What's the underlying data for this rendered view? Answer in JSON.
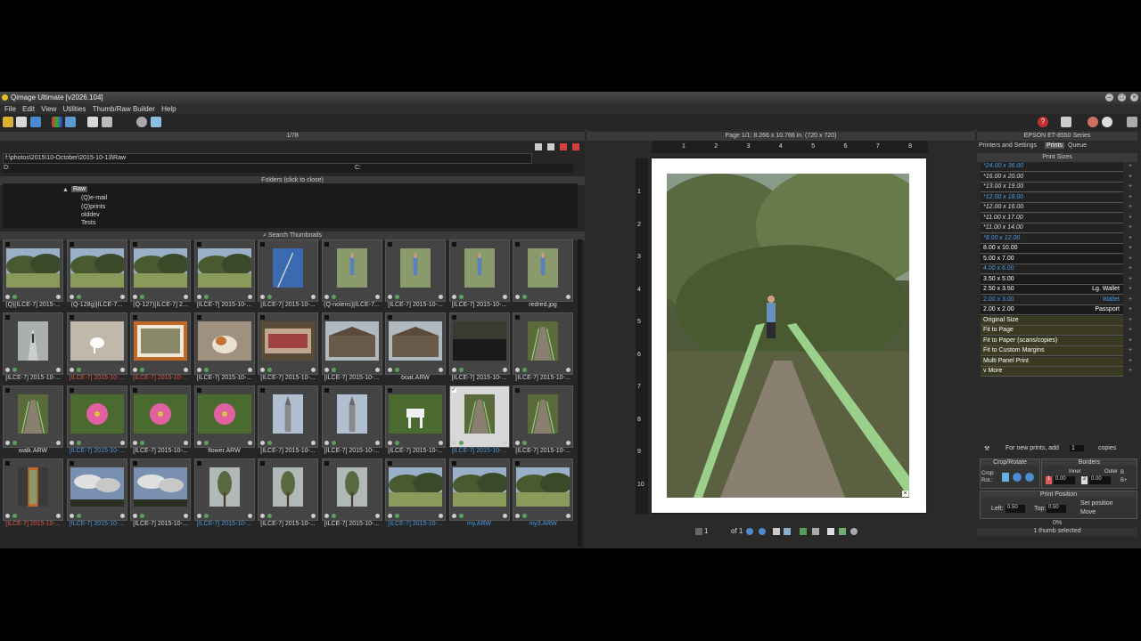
{
  "app": {
    "title": "Qimage Ultimate [v2026.104]"
  },
  "menu": [
    "File",
    "Edit",
    "View",
    "Utilities",
    "Thumb/Raw Builder",
    "Help"
  ],
  "left": {
    "page_counter": "1/78",
    "path": "f:\\photos\\2015\\10-October\\2015-10-13\\Raw",
    "drive_left": "D:",
    "drive_right": "C:",
    "folders_header": "Folders (click to close)",
    "folders": [
      "Raw",
      "(Q)e-mail",
      "(Q)prints",
      "olddev",
      "Tests"
    ],
    "search_header": "Search Thumbnails",
    "thumbnails": [
      {
        "caption": "(Q)[ILCE-7] 2015-...",
        "color": "#dddddd",
        "img": "landscape"
      },
      {
        "caption": "(Q-128g)[ILCE-7...",
        "color": "#dddddd",
        "img": "landscape"
      },
      {
        "caption": "(Q-127)[ILCE-7] 2...",
        "color": "#dddddd",
        "img": "landscape"
      },
      {
        "caption": "[ILCE-7] 2015-10-...",
        "color": "#dddddd",
        "img": "landscape"
      },
      {
        "caption": "[ILCE-7] 2015-10-...",
        "color": "#dddddd",
        "img": "sky"
      },
      {
        "caption": "(Q-nolens)[ILCE-7...",
        "color": "#dddddd",
        "img": "person"
      },
      {
        "caption": "[ILCE-7] 2015-10-...",
        "color": "#dddddd",
        "img": "person"
      },
      {
        "caption": "[ILCE-7] 2015-10-...",
        "color": "#dddddd",
        "img": "person"
      },
      {
        "caption": "redred.jpg",
        "color": "#dddddd",
        "img": "person"
      },
      {
        "caption": "[ILCE-7] 2015-10-...",
        "color": "#dddddd",
        "img": "path"
      },
      {
        "caption": "[ILCE-7] 2015-10-...",
        "color": "#e05a4a",
        "img": "dog"
      },
      {
        "caption": "[ILCE-7] 2015-10-...",
        "color": "#e05a4a",
        "img": "framed"
      },
      {
        "caption": "[ILCE-7] 2015-10-...",
        "color": "#dddddd",
        "img": "cat"
      },
      {
        "caption": "[ILCE-7] 2015-10-...",
        "color": "#dddddd",
        "img": "sign"
      },
      {
        "caption": "[ILCE-7] 2015-10-...",
        "color": "#dddddd",
        "img": "building"
      },
      {
        "caption": "boat.ARW",
        "color": "#dddddd",
        "img": "building"
      },
      {
        "caption": "[ILCE-7] 2015-10-...",
        "color": "#dddddd",
        "img": "dark"
      },
      {
        "caption": "[ILCE-7] 2015-10-...",
        "color": "#dddddd",
        "img": "bridge"
      },
      {
        "caption": "walk.ARW",
        "color": "#dddddd",
        "img": "bridge"
      },
      {
        "caption": "[ILCE-7] 2015-10-...",
        "color": "#4a9ae0",
        "img": "flower"
      },
      {
        "caption": "[ILCE-7] 2015-10-...",
        "color": "#dddddd",
        "img": "flower"
      },
      {
        "caption": "flower.ARW",
        "color": "#dddddd",
        "img": "flower"
      },
      {
        "caption": "[ILCE-7] 2015-10-...",
        "color": "#dddddd",
        "img": "tower"
      },
      {
        "caption": "[ILCE-7] 2015-10-...",
        "color": "#dddddd",
        "img": "tower"
      },
      {
        "caption": "[ILCE-7] 2015-10-...",
        "color": "#dddddd",
        "img": "horse"
      },
      {
        "caption": "[ILCE-7] 2015-10-...",
        "color": "#4a9ae0",
        "img": "bridge",
        "selected": true
      },
      {
        "caption": "[ILCE-7] 2015-10-...",
        "color": "#dddddd",
        "img": "bridge"
      },
      {
        "caption": "[ILCE-7] 2015-10-...",
        "color": "#e05a4a",
        "img": "framedtall"
      },
      {
        "caption": "[ILCE-7] 2015-10-...",
        "color": "#4a9ae0",
        "img": "clouds"
      },
      {
        "caption": "[ILCE-7] 2015-10-...",
        "color": "#dddddd",
        "img": "clouds"
      },
      {
        "caption": "[ILCE-7] 2015-10-...",
        "color": "#4a9ae0",
        "img": "tree"
      },
      {
        "caption": "[ILCE-7] 2015-10-...",
        "color": "#dddddd",
        "img": "tree"
      },
      {
        "caption": "[ILCE-7] 2015-10-...",
        "color": "#dddddd",
        "img": "tree"
      },
      {
        "caption": "[ILCE-7] 2015-10-...",
        "color": "#4a9ae0",
        "img": "landscape"
      },
      {
        "caption": "my.ARW",
        "color": "#4a9ae0",
        "img": "landscape"
      },
      {
        "caption": "my3.ARW",
        "color": "#4a9ae0",
        "img": "landscape"
      }
    ]
  },
  "mid": {
    "page_info": "Page 1/1: 8.266 x 10.766 in.  (720 x 720)",
    "ruler_h": [
      "1",
      "2",
      "3",
      "4",
      "5",
      "6",
      "7",
      "8"
    ],
    "ruler_v": [
      "1",
      "2",
      "3",
      "4",
      "5",
      "6",
      "7",
      "8",
      "9",
      "10"
    ],
    "page_input": "1",
    "page_of": "of 1"
  },
  "right": {
    "printer": "EPSON ET-8550 Series",
    "tabs": [
      "Printers and Settings",
      "Prints",
      "Queue"
    ],
    "print_sizes_header": "Print Sizes",
    "sizes": [
      {
        "label": "*24.00 x 36.00",
        "note": "",
        "color": "#4a9ae0"
      },
      {
        "label": "*16.00 x 20.00",
        "note": "",
        "color": "#dddddd"
      },
      {
        "label": "*13.00 x 19.00",
        "note": "",
        "color": "#dddddd"
      },
      {
        "label": "*12.00 x 18.00",
        "note": "",
        "color": "#4a9ae0"
      },
      {
        "label": "*12.00 x 16.00",
        "note": "",
        "color": "#dddddd"
      },
      {
        "label": "*11.00 x 17.00",
        "note": "",
        "color": "#dddddd"
      },
      {
        "label": "*11.00 x 14.00",
        "note": "",
        "color": "#dddddd"
      },
      {
        "label": "*8.00 x 12.00",
        "note": "",
        "color": "#4a9ae0"
      },
      {
        "label": "8.00 x 10.00",
        "note": "",
        "color": "#ffffff"
      },
      {
        "label": "5.00 x 7.00",
        "note": "",
        "color": "#ffffff"
      },
      {
        "label": "4.00 x 6.00",
        "note": "",
        "color": "#4a9ae0"
      },
      {
        "label": "3.50 x 5.00",
        "note": "",
        "color": "#ffffff"
      },
      {
        "label": "2.50 x 3.50",
        "note": "Lg. Wallet",
        "color": "#ffffff"
      },
      {
        "label": "2.00 x 3.00",
        "note": "Wallet",
        "color": "#4a9ae0"
      },
      {
        "label": "2.00 x 2.00",
        "note": "Passport",
        "color": "#ffffff"
      },
      {
        "label": "Original Size",
        "note": "",
        "color": "#ffffff"
      },
      {
        "label": "Fit to Page",
        "note": "",
        "color": "#ffffff"
      },
      {
        "label": "Fit to Paper (scans/copies)",
        "note": "",
        "color": "#ffffff"
      },
      {
        "label": "Fit to Custom Margins",
        "note": "",
        "color": "#ffffff"
      },
      {
        "label": "Multi Panel Print",
        "note": "",
        "color": "#ffffff"
      },
      {
        "label": "v More",
        "note": "",
        "color": "#ffffff"
      }
    ],
    "copies_label": "For new prints, add",
    "copies_value": "1",
    "copies_unit": "copies",
    "crop_rotate": "Crop/Rotate",
    "crop": "Crop:",
    "rot": "Rot.:",
    "borders": "Borders",
    "inner": "Inner",
    "outer": "Outer",
    "inner_value": "0.00",
    "outer_value": "0.00",
    "print_position": "Print Position",
    "left_label": "Left:",
    "left_value": "0.50",
    "top_label": "Top:",
    "top_value": "0.50",
    "set_position": "Set position",
    "move": "Move",
    "percent": "0%",
    "status": "1 thumb selected"
  }
}
